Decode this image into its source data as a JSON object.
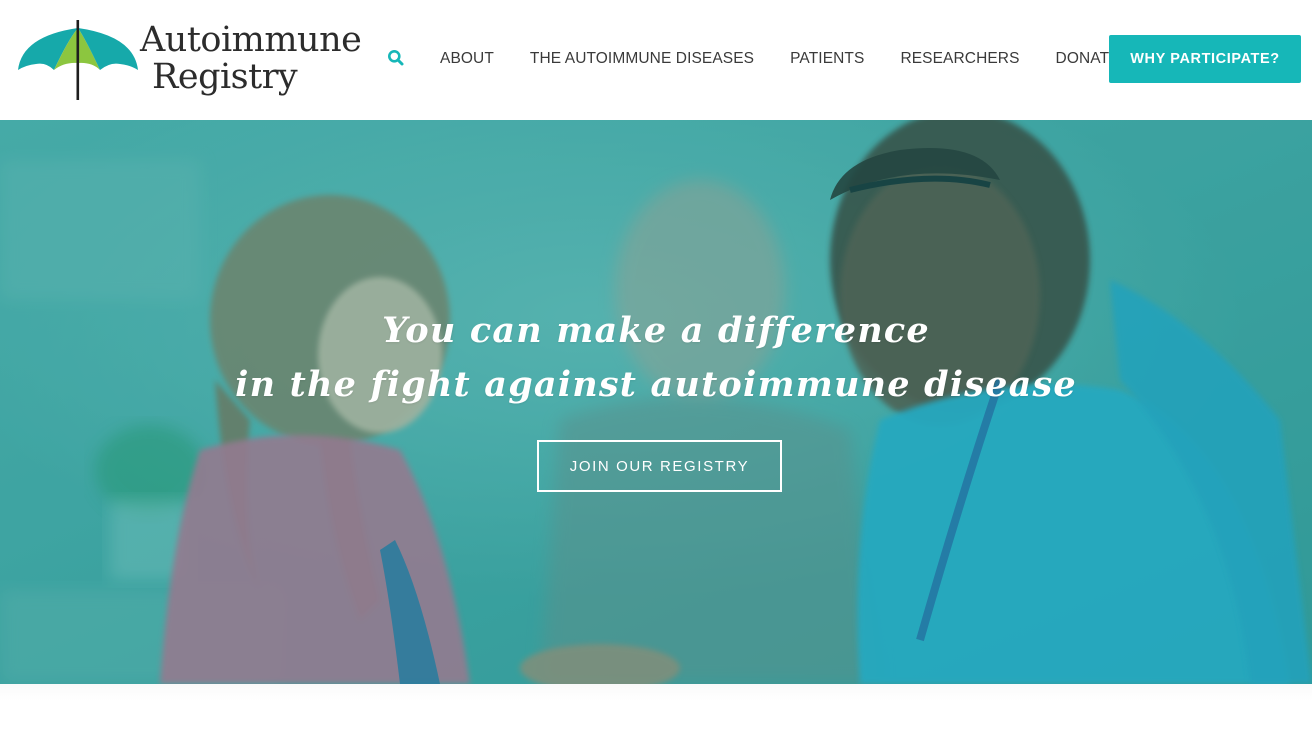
{
  "brand": {
    "line1": "Autoimmune",
    "line2": "Registry",
    "colors": {
      "teal": "#16b7b8",
      "green": "#8cc63f",
      "text": "#2c2c2c"
    }
  },
  "header": {
    "search_icon": "search-icon",
    "nav": [
      {
        "label": "ABOUT"
      },
      {
        "label": "THE AUTOIMMUNE DISEASES"
      },
      {
        "label": "PATIENTS"
      },
      {
        "label": "RESEARCHERS"
      },
      {
        "label": "DONATE"
      }
    ],
    "cta_label": "WHY PARTICIPATE?"
  },
  "hero": {
    "line1": "You can make a difference",
    "line2": "in the fight against autoimmune disease",
    "cta_label": "JOIN OUR REGISTRY",
    "overlay_color": "#169696"
  }
}
